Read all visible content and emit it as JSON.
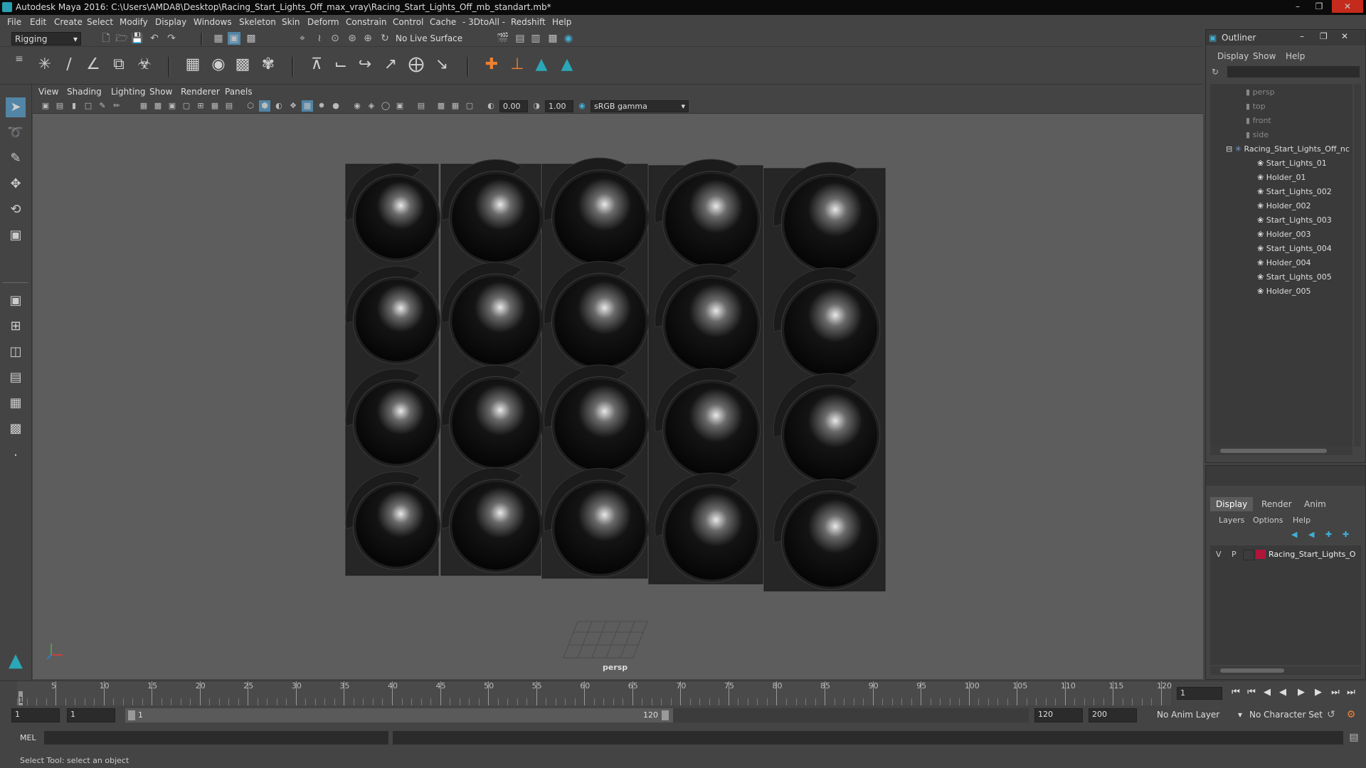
{
  "window": {
    "title": "Autodesk Maya 2016: C:\\Users\\AMDA8\\Desktop\\Racing_Start_Lights_Off_max_vray\\Racing_Start_Lights_Off_mb_standart.mb*"
  },
  "menu": [
    "File",
    "Edit",
    "Create",
    "Select",
    "Modify",
    "Display",
    "Windows",
    "Skeleton",
    "Skin",
    "Deform",
    "Constrain",
    "Control",
    "Cache",
    "- 3DtoAll -",
    "Redshift",
    "Help"
  ],
  "shelf": {
    "mode": "Rigging",
    "live_surface": "No Live Surface"
  },
  "viewport": {
    "menu": [
      "View",
      "Shading",
      "Lighting",
      "Show",
      "Renderer",
      "Panels"
    ],
    "exposure": "0.00",
    "gamma": "1.00",
    "color_space": "sRGB gamma",
    "camera_label": "persp"
  },
  "outliner": {
    "title": "Outliner",
    "menu": [
      "Display",
      "Show",
      "Help"
    ],
    "cameras": [
      "persp",
      "top",
      "front",
      "side"
    ],
    "root": "Racing_Start_Lights_Off_nc",
    "children": [
      "Start_Lights_01",
      "Holder_01",
      "Start_Lights_002",
      "Holder_002",
      "Start_Lights_003",
      "Holder_003",
      "Start_Lights_004",
      "Holder_004",
      "Start_Lights_005",
      "Holder_005"
    ]
  },
  "layers": {
    "tabs": [
      "Display",
      "Render",
      "Anim"
    ],
    "active_tab": "Display",
    "menu": [
      "Layers",
      "Options",
      "Help"
    ],
    "row": {
      "v": "V",
      "p": "P",
      "name": "Racing_Start_Lights_O",
      "color": "#b0163a"
    }
  },
  "timeline": {
    "ticks": [
      "5",
      "10",
      "15",
      "20",
      "25",
      "30",
      "35",
      "40",
      "45",
      "50",
      "55",
      "60",
      "65",
      "70",
      "75",
      "80",
      "85",
      "90",
      "95",
      "100",
      "105",
      "110",
      "115",
      "120"
    ],
    "current_frame": "1",
    "frame_field": "1"
  },
  "range": {
    "start": "1",
    "anim_start": "1",
    "slider_start": "1",
    "slider_end": "120",
    "anim_end": "120",
    "end": "200",
    "anim_layer": "No Anim Layer",
    "char_set": "No Character Set"
  },
  "mel": {
    "label": "MEL"
  },
  "status": {
    "text": "Select Tool: select an object"
  }
}
